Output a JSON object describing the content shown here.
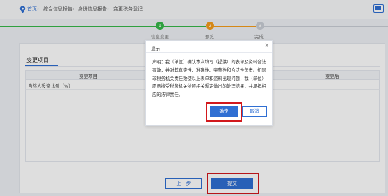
{
  "breadcrumb": {
    "home": "首页",
    "items": [
      "综合信息报告",
      "身份信息报告",
      "变更税务登记"
    ]
  },
  "steps": [
    {
      "number": "1",
      "label": "信息变更",
      "status": "done"
    },
    {
      "number": "2",
      "label": "预览",
      "status": "current"
    },
    {
      "number": "3",
      "label": "完成",
      "status": "pending"
    }
  ],
  "section_tab": "变更项目",
  "table": {
    "columns": [
      "变更项目",
      "变更后"
    ],
    "rows": [
      [
        "自然人投资比例（%）"
      ]
    ]
  },
  "buttons": {
    "prev": "上一步",
    "submit": "提交"
  },
  "dialog": {
    "title": "提示",
    "close": "×",
    "message": "声明：我（单位）确认本次填写（提供）的表单及资料合法有效，并对其真实性、准确性、完整性和合法性负责。如因非税务机关责任致使以上表单和资料出现问题，我（单位）愿意接受税务机关依照相关规定做出的处理结果，并承担相应的法律责任。",
    "ok": "确定",
    "cancel": "取消"
  },
  "colors": {
    "accent": "#2f6fd3",
    "step_done": "#37b84a",
    "step_current": "#f59d1b",
    "step_pending": "#c9ced6",
    "highlight": "#d2191d"
  },
  "icons": [
    "location-pin-icon",
    "window-icon",
    "close-icon"
  ]
}
